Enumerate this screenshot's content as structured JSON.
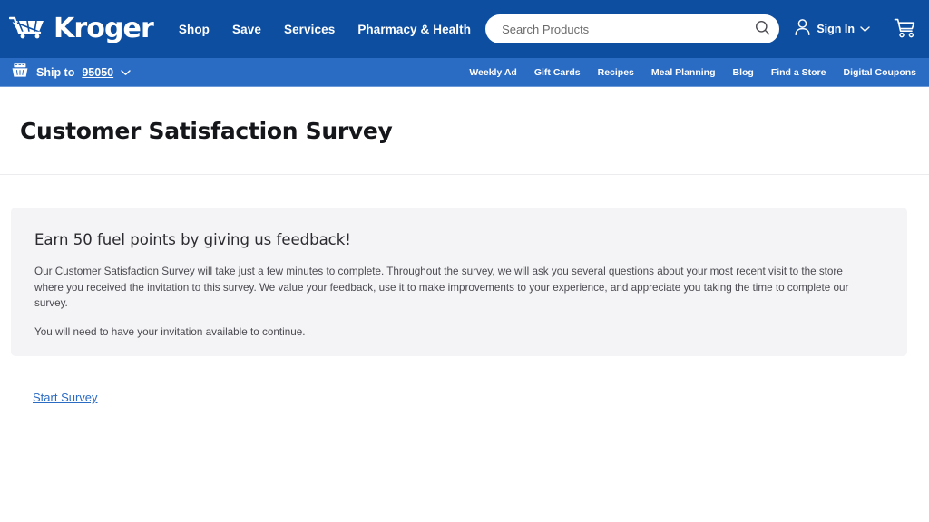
{
  "header": {
    "logo": {
      "icon": "kroger-cart-logo-icon",
      "wordmark": "Kroger"
    },
    "nav_items": [
      {
        "label": "Shop",
        "name": "nav-shop"
      },
      {
        "label": "Save",
        "name": "nav-save"
      },
      {
        "label": "Services",
        "name": "nav-services"
      },
      {
        "label": "Pharmacy & Health",
        "name": "nav-pharmacy-health"
      }
    ],
    "search": {
      "placeholder": "Search Products",
      "value": "",
      "icon": "search-icon"
    },
    "account": {
      "label": "Sign In",
      "person_icon": "person-icon",
      "chevron_icon": "chevron-down-icon"
    },
    "cart": {
      "icon": "shopping-cart-icon"
    },
    "colors": {
      "top_bar": "#0d4ea0",
      "sub_bar": "#2a6bc4"
    }
  },
  "subnav": {
    "ship_to": {
      "prefix": "Ship to",
      "zip": "95050",
      "basket_icon": "basket-icon",
      "chevron_icon": "chevron-down-icon"
    },
    "links": [
      {
        "label": "Weekly Ad",
        "name": "subnav-weekly-ad"
      },
      {
        "label": "Gift Cards",
        "name": "subnav-gift-cards"
      },
      {
        "label": "Recipes",
        "name": "subnav-recipes"
      },
      {
        "label": "Meal Planning",
        "name": "subnav-meal-planning"
      },
      {
        "label": "Blog",
        "name": "subnav-blog"
      },
      {
        "label": "Find a Store",
        "name": "subnav-find-a-store"
      },
      {
        "label": "Digital Coupons",
        "name": "subnav-digital-coupons"
      }
    ]
  },
  "page": {
    "title": "Customer Satisfaction Survey"
  },
  "main": {
    "panel": {
      "heading": "Earn 50 fuel points by giving us feedback!",
      "paragraph_1": "Our Customer Satisfaction Survey will take just a few minutes to complete. Throughout the survey, we will ask you several questions about your most recent visit to the store where you received the invitation to this survey. We value your feedback, use it to make improvements to your experience, and appreciate you taking the time to complete our survey.",
      "paragraph_2": "You will need to have your invitation available to continue.",
      "background": "#f4f4f6"
    },
    "start_link": {
      "label": "Start Survey",
      "color": "#2a6bc4"
    }
  }
}
